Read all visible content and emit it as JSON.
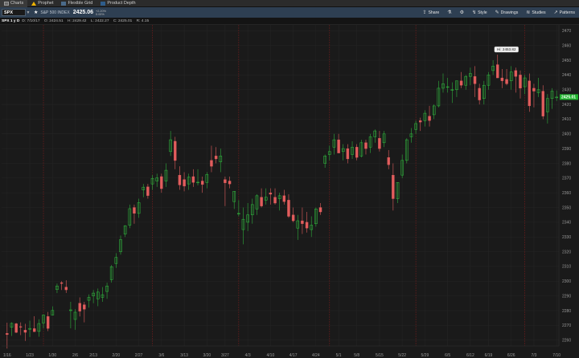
{
  "tabs": [
    {
      "label": "Charts",
      "icon": "chart-icon",
      "active": true
    },
    {
      "label": "Prophet",
      "icon": "warning-icon",
      "active": false
    },
    {
      "label": "Flexible Grid",
      "icon": "grid-icon",
      "active": false
    },
    {
      "label": "Product Depth",
      "icon": "depth-icon",
      "active": false
    }
  ],
  "toolbar": {
    "symbol": "SPX",
    "description": "S&P 500 INDEX",
    "last": "2425.06",
    "change_line1": "+2.20%",
    "change_line2": "0.00%",
    "share": "Share",
    "style": "Style",
    "drawings": "Drawings",
    "studies": "Studies",
    "patterns": "Patterns"
  },
  "chart_header": {
    "tag": "SPX 1 y D",
    "date": "D: 7/10/17",
    "open": "O: 2424.51",
    "high": "H: 2429.42",
    "low": "L: 2422.27",
    "close": "C: 2425.01",
    "range": "R: 4.15",
    "copyright": "© 2017 © TD Ameritrade IP Company, Inc."
  },
  "chart_data": {
    "type": "candlestick",
    "symbol": "SPX",
    "x_ticks": [
      "1/16",
      "1/23",
      "1/30",
      "2/6",
      "2/13",
      "2/20",
      "2/27",
      "3/6",
      "3/13",
      "3/20",
      "3/27",
      "4/3",
      "4/10",
      "4/17",
      "4/24",
      "5/1",
      "5/8",
      "5/15",
      "5/22",
      "5/29",
      "6/5",
      "6/12",
      "6/19",
      "6/26",
      "7/3",
      "7/10"
    ],
    "y_ticks": [
      2260,
      2270,
      2280,
      2290,
      2300,
      2310,
      2320,
      2330,
      2340,
      2350,
      2360,
      2370,
      2380,
      2390,
      2400,
      2410,
      2420,
      2430,
      2440,
      2450,
      2460,
      2470
    ],
    "ylim": [
      2256,
      2474
    ],
    "high_label": "Hi: 2453.82",
    "last_label": "2425.01",
    "candles": [
      [
        2264.56,
        2271.78,
        2254.25,
        2263.69
      ],
      [
        2268.68,
        2272.08,
        2262.81,
        2271.31
      ],
      [
        2271.11,
        2271.64,
        2264.81,
        2265.2
      ],
      [
        2269.14,
        2272.01,
        2263.35,
        2268.9
      ],
      [
        2266.78,
        2271.06,
        2259.39,
        2265.23
      ],
      [
        2267.34,
        2273.14,
        2262.07,
        2267.89
      ],
      [
        2267.78,
        2276.2,
        2265.5,
        2265.66
      ],
      [
        2265.9,
        2274.11,
        2262.26,
        2271.2
      ],
      [
        2271.6,
        2277.4,
        2268.0,
        2277.0
      ],
      [
        2276.0,
        2279.1,
        2266.1,
        2267.9
      ],
      [
        2277.0,
        2282.9,
        2276.7,
        2280.1
      ],
      [
        2294.3,
        2298.4,
        2291.9,
        2296.7
      ],
      [
        2299.0,
        2300.0,
        2294.0,
        2298.4
      ],
      [
        2296.0,
        2300.6,
        2292.0,
        2294.1
      ],
      [
        2280.0,
        2286.0,
        2268.0,
        2280.5
      ],
      [
        2274.0,
        2281.0,
        2267.0,
        2278.9
      ],
      [
        2285.0,
        2289.0,
        2276.0,
        2279.6
      ],
      [
        2284.0,
        2286.0,
        2272.0,
        2280.9
      ],
      [
        2287.0,
        2291.0,
        2282.0,
        2289.0
      ],
      [
        2290.0,
        2294.0,
        2285.0,
        2291.9
      ],
      [
        2288.0,
        2295.0,
        2283.0,
        2292.6
      ],
      [
        2289.0,
        2296.0,
        2286.0,
        2290.8
      ],
      [
        2293.0,
        2299.0,
        2288.0,
        2296.7
      ],
      [
        2301.0,
        2311.0,
        2299.0,
        2309.8
      ],
      [
        2312.0,
        2319.0,
        2309.0,
        2316.1
      ],
      [
        2320.0,
        2331.0,
        2318.0,
        2328.2
      ],
      [
        2332.0,
        2338.0,
        2330.0,
        2337.6
      ],
      [
        2338.0,
        2352.0,
        2336.0,
        2349.2
      ],
      [
        2350.0,
        2352.0,
        2339.0,
        2346.0
      ],
      [
        2346.0,
        2356.0,
        2343.0,
        2353.3
      ],
      [
        2362.0,
        2366.0,
        2357.0,
        2363.8
      ],
      [
        2364.0,
        2366.0,
        2356.0,
        2358.1
      ],
      [
        2366.0,
        2372.0,
        2362.0,
        2369.7
      ],
      [
        2368.0,
        2373.0,
        2364.0,
        2370.1
      ],
      [
        2371.0,
        2373.0,
        2360.0,
        2362.8
      ],
      [
        2368.0,
        2380.0,
        2364.0,
        2375.3
      ],
      [
        2388.0,
        2402.0,
        2385.0,
        2396.0
      ],
      [
        2395.0,
        2398.0,
        2376.0,
        2381.9
      ],
      [
        2372.0,
        2378.0,
        2362.0,
        2365.3
      ],
      [
        2369.0,
        2374.0,
        2361.0,
        2364.5
      ],
      [
        2366.0,
        2373.0,
        2362.0,
        2370.6
      ],
      [
        2371.0,
        2376.0,
        2364.0,
        2367.0
      ],
      [
        2367.0,
        2376.0,
        2365.0,
        2367.2
      ],
      [
        2368.0,
        2371.0,
        2360.0,
        2365.6
      ],
      [
        2367.0,
        2374.0,
        2363.0,
        2372.4
      ],
      [
        2382.0,
        2392.0,
        2374.0,
        2378.0
      ],
      [
        2385.0,
        2391.0,
        2380.0,
        2383.0
      ],
      [
        2381.0,
        2390.0,
        2374.0,
        2385.0
      ],
      [
        2369.0,
        2371.0,
        2351.0,
        2366.7
      ],
      [
        2368.0,
        2371.0,
        2363.0,
        2366.0
      ],
      [
        2354.0,
        2361.0,
        2349.0,
        2361.0
      ],
      [
        2346.0,
        2355.0,
        2344.0,
        2346.0
      ],
      [
        2335.0,
        2350.0,
        2325.0,
        2342.0
      ],
      [
        2340.0,
        2353.0,
        2334.0,
        2345.0
      ],
      [
        2345.0,
        2356.0,
        2339.0,
        2352.0
      ],
      [
        2349.0,
        2359.0,
        2345.0,
        2358.0
      ],
      [
        2357.0,
        2363.0,
        2350.0,
        2351.0
      ],
      [
        2355.0,
        2363.0,
        2352.0,
        2357.0
      ],
      [
        2360.0,
        2363.0,
        2352.0,
        2359.0
      ],
      [
        2357.0,
        2363.0,
        2352.0,
        2353.0
      ],
      [
        2356.0,
        2360.0,
        2348.0,
        2358.0
      ],
      [
        2358.0,
        2362.0,
        2352.0,
        2354.0
      ],
      [
        2355.0,
        2359.0,
        2343.0,
        2344.0
      ],
      [
        2345.0,
        2350.0,
        2340.0,
        2341.0
      ],
      [
        2336.0,
        2345.0,
        2328.0,
        2341.0
      ],
      [
        2341.0,
        2350.0,
        2332.0,
        2339.0
      ],
      [
        2340.0,
        2347.0,
        2333.0,
        2336.0
      ],
      [
        2335.0,
        2344.0,
        2330.0,
        2338.0
      ],
      [
        2339.0,
        2350.0,
        2337.0,
        2349.0
      ],
      [
        2350.0,
        2353.0,
        2345.0,
        2347.0
      ],
      [
        2380.0,
        2386.0,
        2377.0,
        2385.0
      ],
      [
        2386.0,
        2392.0,
        2382.0,
        2388.0
      ],
      [
        2391.0,
        2400.0,
        2386.0,
        2396.0
      ],
      [
        2396.0,
        2400.0,
        2387.0,
        2387.0
      ],
      [
        2388.0,
        2393.0,
        2382.0,
        2390.0
      ],
      [
        2390.0,
        2393.0,
        2380.0,
        2383.0
      ],
      [
        2386.0,
        2395.0,
        2383.0,
        2391.0
      ],
      [
        2391.0,
        2393.0,
        2382.0,
        2384.0
      ],
      [
        2385.0,
        2396.0,
        2384.0,
        2394.0
      ],
      [
        2394.0,
        2396.0,
        2386.0,
        2390.0
      ],
      [
        2391.0,
        2400.0,
        2387.0,
        2398.0
      ],
      [
        2398.0,
        2403.0,
        2394.0,
        2402.0
      ],
      [
        2397.0,
        2402.0,
        2388.0,
        2390.0
      ],
      [
        2394.0,
        2402.0,
        2391.0,
        2400.0
      ],
      [
        2384.0,
        2389.0,
        2376.0,
        2379.0
      ],
      [
        2372.0,
        2380.0,
        2348.0,
        2356.0
      ],
      [
        2356.0,
        2367.0,
        2353.0,
        2367.0
      ],
      [
        2372.0,
        2386.0,
        2370.0,
        2382.0
      ],
      [
        2382.0,
        2397.0,
        2380.0,
        2396.0
      ],
      [
        2398.0,
        2404.0,
        2394.0,
        2400.0
      ],
      [
        2403.0,
        2409.0,
        2400.0,
        2407.0
      ],
      [
        2409.0,
        2411.0,
        2402.0,
        2408.0
      ],
      [
        2409.0,
        2416.0,
        2405.0,
        2414.0
      ],
      [
        2412.0,
        2419.0,
        2405.0,
        2409.0
      ],
      [
        2413.0,
        2420.0,
        2410.0,
        2419.0
      ],
      [
        2419.0,
        2436.0,
        2418.0,
        2431.0
      ],
      [
        2431.0,
        2441.0,
        2428.0,
        2434.0
      ],
      [
        2432.0,
        2438.0,
        2428.0,
        2432.0
      ],
      [
        2430.0,
        2435.0,
        2421.0,
        2430.0
      ],
      [
        2430.0,
        2436.0,
        2425.0,
        2436.0
      ],
      [
        2436.0,
        2442.0,
        2431.0,
        2433.0
      ],
      [
        2433.0,
        2440.0,
        2430.0,
        2439.0
      ],
      [
        2439.0,
        2445.0,
        2433.0,
        2441.0
      ],
      [
        2439.0,
        2446.0,
        2425.0,
        2434.0
      ],
      [
        2431.0,
        2434.0,
        2420.0,
        2423.0
      ],
      [
        2424.0,
        2436.0,
        2420.0,
        2433.0
      ],
      [
        2433.0,
        2442.0,
        2430.0,
        2440.0
      ],
      [
        2443.0,
        2450.0,
        2440.0,
        2446.0
      ],
      [
        2447.0,
        2453.8,
        2438.0,
        2438.0
      ],
      [
        2438.0,
        2444.0,
        2431.0,
        2436.0
      ],
      [
        2437.0,
        2444.0,
        2433.0,
        2434.0
      ],
      [
        2436.0,
        2446.0,
        2430.0,
        2442.0
      ],
      [
        2443.0,
        2445.0,
        2428.0,
        2439.0
      ],
      [
        2440.0,
        2443.0,
        2424.0,
        2431.0
      ],
      [
        2432.0,
        2440.0,
        2427.0,
        2438.0
      ],
      [
        2436.0,
        2441.0,
        2415.0,
        2419.0
      ],
      [
        2431.0,
        2434.0,
        2418.0,
        2429.0
      ],
      [
        2428.0,
        2438.0,
        2425.0,
        2430.0
      ],
      [
        2429.0,
        2433.0,
        2410.0,
        2412.0
      ],
      [
        2415.0,
        2427.0,
        2407.0,
        2424.0
      ],
      [
        2424.0,
        2431.0,
        2417.0,
        2429.0
      ],
      [
        2424.51,
        2429.42,
        2422.27,
        2425.01
      ]
    ]
  },
  "colors": {
    "up": "#2fae3c",
    "down": "#e25d5d",
    "grid": "#262626",
    "month_line": "#6e1d1d",
    "last_label_bg": "#1fb52d"
  }
}
